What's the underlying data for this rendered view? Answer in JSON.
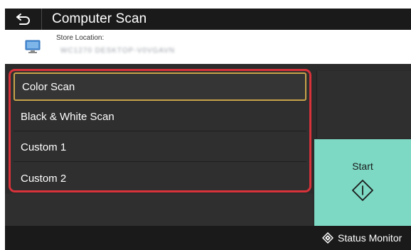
{
  "header": {
    "title": "Computer Scan"
  },
  "location": {
    "label": "Store Location:",
    "value": "WC1270 DESKTOP-V0VGAVN"
  },
  "menu": {
    "items": [
      {
        "label": "Color Scan",
        "selected": true
      },
      {
        "label": "Black & White Scan",
        "selected": false
      },
      {
        "label": "Custom 1",
        "selected": false
      },
      {
        "label": "Custom 2",
        "selected": false
      }
    ]
  },
  "start_button": {
    "label": "Start"
  },
  "footer": {
    "status_monitor_label": "Status Monitor"
  },
  "colors": {
    "highlight_border": "#d8323a",
    "start_button": "#7dd9c4",
    "selected_item_border": "#c9a24a"
  }
}
